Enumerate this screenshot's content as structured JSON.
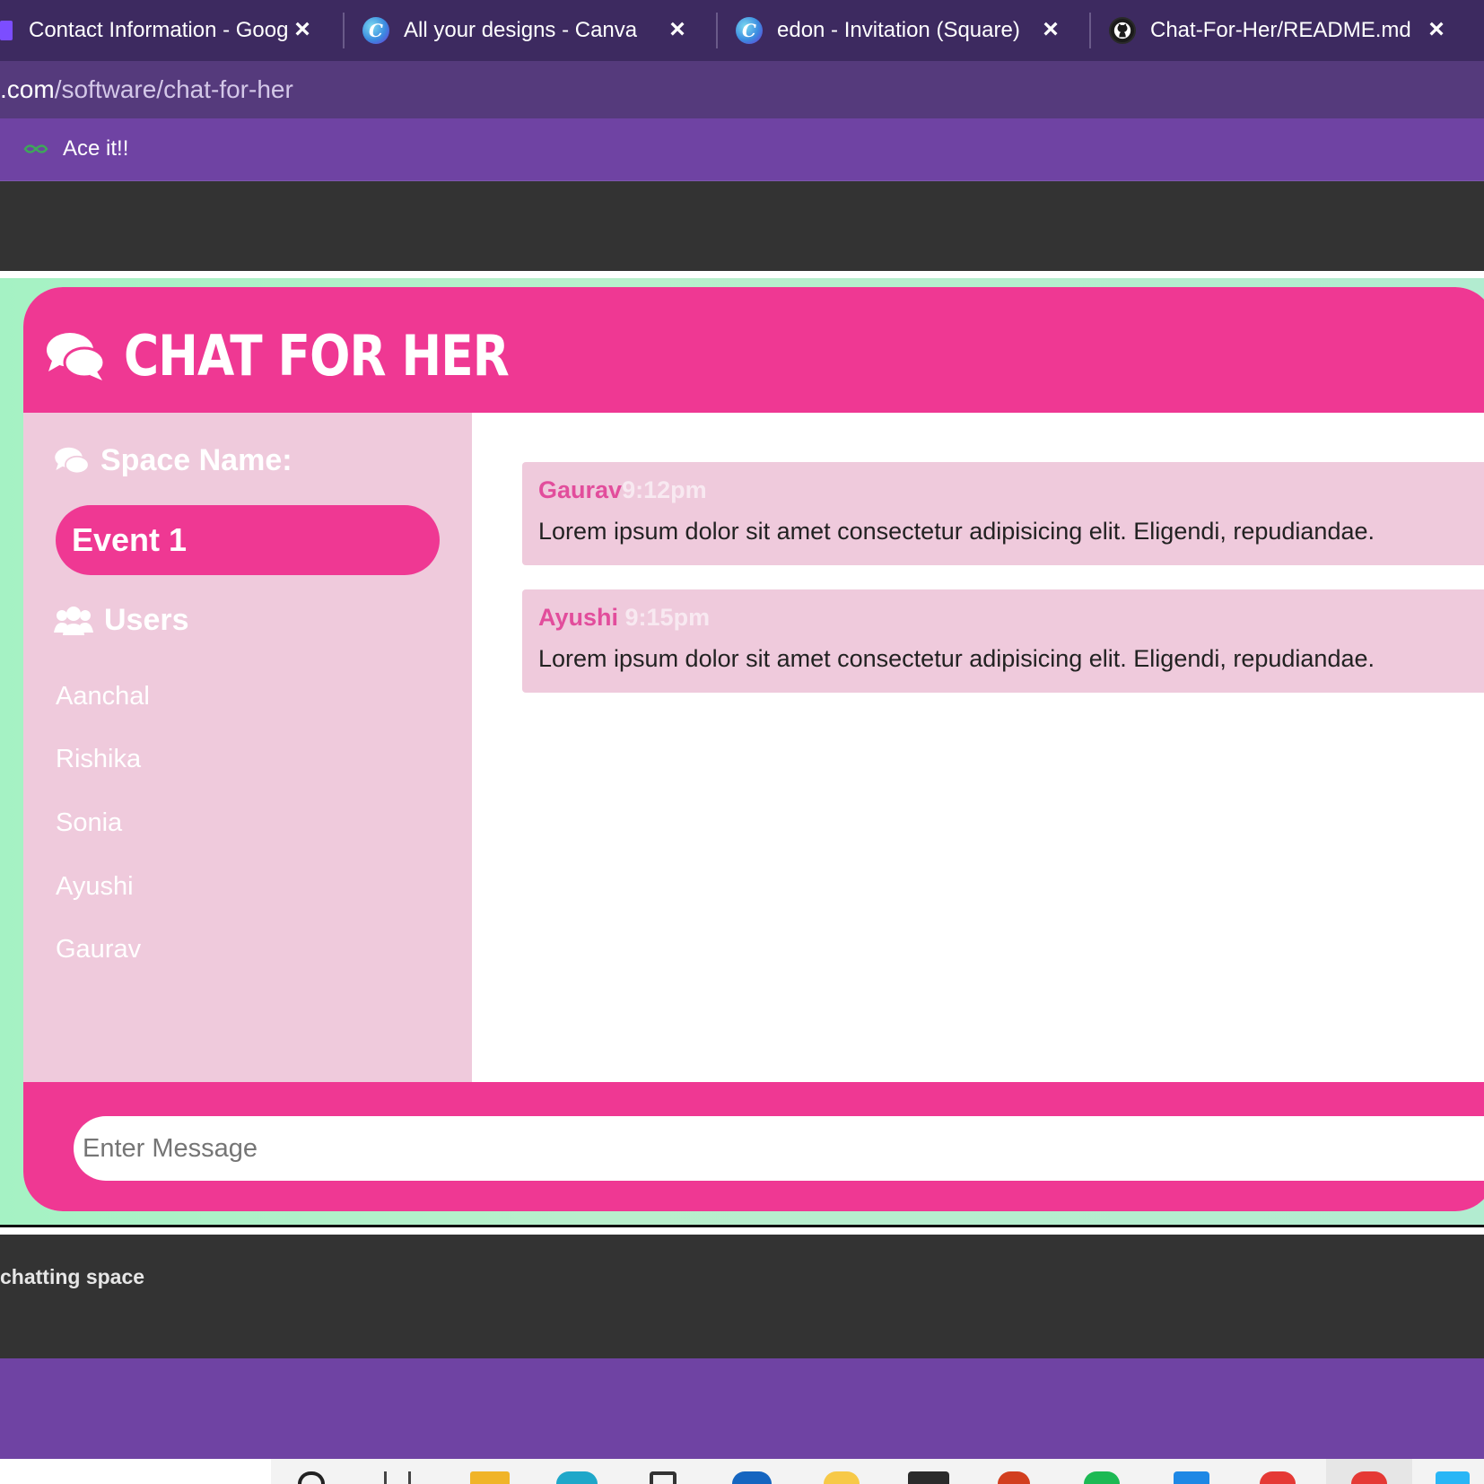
{
  "browser": {
    "tabs": [
      {
        "title": "Contact Information - Goog",
        "icon": "forms-icon"
      },
      {
        "title": "All your designs - Canva",
        "icon": "canva-icon"
      },
      {
        "title": "edon - Invitation (Square)",
        "icon": "canva-icon"
      },
      {
        "title": "Chat-For-Her/README.md",
        "icon": "github-icon"
      }
    ],
    "url_host": ".com",
    "url_path": "/software/chat-for-her",
    "bookmark": {
      "label": "Ace it!!",
      "icon": "bookmark-icon"
    }
  },
  "app": {
    "title": "CHAT FOR HER",
    "sidebar": {
      "space_heading": "Space Name:",
      "room_name": "Event 1",
      "users_heading": "Users",
      "users": [
        "Aanchal",
        "Rishika",
        "Sonia",
        "Ayushi",
        "Gaurav"
      ]
    },
    "messages": [
      {
        "sender": "Gaurav",
        "time": "9:12pm",
        "text": "Lorem ipsum dolor sit amet consectetur adipisicing elit. Eligendi, repudiandae."
      },
      {
        "sender": "Ayushi",
        "time": "9:15pm",
        "text": "Lorem ipsum dolor sit amet consectetur adipisicing elit. Eligendi, repudiandae."
      }
    ],
    "input": {
      "placeholder": "Enter Message"
    }
  },
  "caption": "chatting space",
  "colors": {
    "accent_pink": "#ef3893",
    "light_pink": "#efcadc",
    "mint": "#a5f2c4",
    "purple": "#6f43a3",
    "dark": "#333333"
  }
}
